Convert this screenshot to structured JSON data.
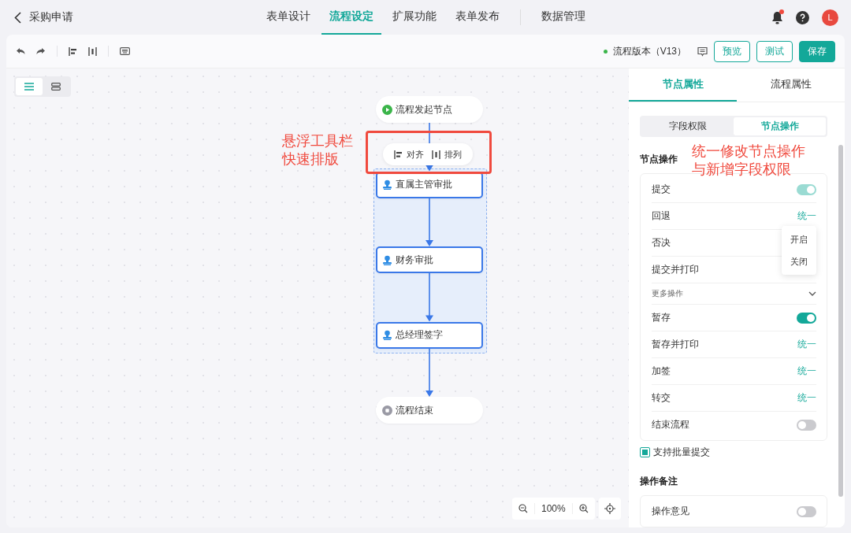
{
  "header": {
    "title": "采购申请",
    "tabs": [
      {
        "label": "表单设计",
        "selected": false,
        "divider_before": false
      },
      {
        "label": "流程设定",
        "selected": true,
        "divider_before": false
      },
      {
        "label": "扩展功能",
        "selected": false,
        "divider_before": false
      },
      {
        "label": "表单发布",
        "selected": false,
        "divider_before": false
      },
      {
        "label": "数据管理",
        "selected": false,
        "divider_before": true
      }
    ],
    "has_notification": true,
    "avatar": "L"
  },
  "toolbar": {
    "version": "流程版本（V13）",
    "buttons": [
      {
        "label": "预览",
        "kind": "outline"
      },
      {
        "label": "测试",
        "kind": "outline"
      },
      {
        "label": "保存",
        "kind": "primary"
      }
    ]
  },
  "view_toggle": [
    {
      "kind": "list",
      "selected": true
    },
    {
      "kind": "stack",
      "selected": false
    }
  ],
  "flow": {
    "nodes": [
      {
        "label": "流程发起节点",
        "kind": "start",
        "selected": false
      },
      {
        "label": "直属主管审批",
        "kind": "approver",
        "selected": true
      },
      {
        "label": "财务审批",
        "kind": "approver",
        "selected": true
      },
      {
        "label": "总经理签字",
        "kind": "approver",
        "selected": true
      },
      {
        "label": "流程结束",
        "kind": "end",
        "selected": false
      }
    ],
    "float_toolbar": [
      {
        "label": "对齐",
        "kind": "align"
      },
      {
        "label": "排列",
        "kind": "distribute"
      }
    ],
    "zoom": "100%"
  },
  "annotations": [
    {
      "lines": [
        "悬浮工具栏",
        "快速排版"
      ]
    },
    {
      "lines": [
        "统一修改节点操作",
        "与新增字段权限"
      ]
    }
  ],
  "panel": {
    "tabs": [
      {
        "label": "节点属性",
        "selected": true
      },
      {
        "label": "流程属性",
        "selected": false
      }
    ],
    "segments": [
      {
        "label": "字段权限",
        "selected": false
      },
      {
        "label": "节点操作",
        "selected": true
      }
    ],
    "sections": [
      {
        "title": "节点操作",
        "rows": [
          {
            "label": "提交",
            "kind": "toggle",
            "on": true,
            "disabled": true
          },
          {
            "label": "回退",
            "kind": "link",
            "action": "统一",
            "menu": [
              "开启",
              "关闭"
            ]
          },
          {
            "label": "否决",
            "kind": "plain"
          },
          {
            "label": "提交并打印",
            "kind": "plain"
          },
          {
            "label": "更多操作",
            "kind": "group",
            "expanded": true
          },
          {
            "label": "暂存",
            "kind": "toggle",
            "on": true,
            "disabled": false
          },
          {
            "label": "暂存并打印",
            "kind": "link",
            "action": "统一"
          },
          {
            "label": "加签",
            "kind": "link",
            "action": "统一"
          },
          {
            "label": "转交",
            "kind": "link",
            "action": "统一"
          },
          {
            "label": "结束流程",
            "kind": "toggle",
            "on": false,
            "disabled": false
          }
        ],
        "checkbox": {
          "label": "支持批量提交",
          "checked": true
        }
      },
      {
        "title": "操作备注",
        "rows": [
          {
            "label": "操作意见",
            "kind": "toggle",
            "on": false,
            "disabled": false
          }
        ]
      }
    ]
  }
}
